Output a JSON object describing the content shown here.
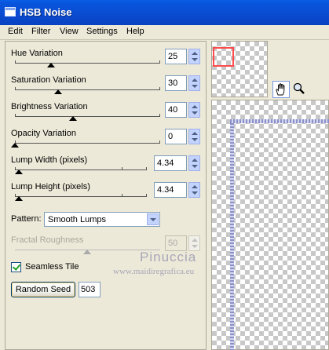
{
  "window": {
    "title": "HSB Noise"
  },
  "menu": [
    "Edit",
    "Filter",
    "View",
    "Settings",
    "Help"
  ],
  "controls": {
    "hue": {
      "label": "Hue Variation",
      "value": "25"
    },
    "saturation": {
      "label": "Saturation Variation",
      "value": "30"
    },
    "brightness": {
      "label": "Brightness Variation",
      "value": "40"
    },
    "opacity": {
      "label": "Opacity Variation",
      "value": "0"
    },
    "lump_width": {
      "label": "Lump Width (pixels)",
      "value": "4.34"
    },
    "lump_height": {
      "label": "Lump Height (pixels)",
      "value": "4.34"
    },
    "fractal": {
      "label": "Fractal Roughness",
      "value": "50"
    }
  },
  "pattern": {
    "label": "Pattern:",
    "value": "Smooth Lumps"
  },
  "seamless": {
    "label": "Seamless Tile",
    "checked": true
  },
  "random_seed": {
    "button_label": "Random Seed",
    "value": "503"
  },
  "watermark": {
    "name": "Pinuccia",
    "url": "www.maidiregrafica.eu"
  },
  "colors": {
    "titlebar": "#0a4bd0",
    "window_bg": "#ece9d8",
    "nav_rect": "#ff4b4b"
  },
  "icons": [
    "hand-pan-icon",
    "magnifier-zoom-icon",
    "app-window-icon"
  ]
}
